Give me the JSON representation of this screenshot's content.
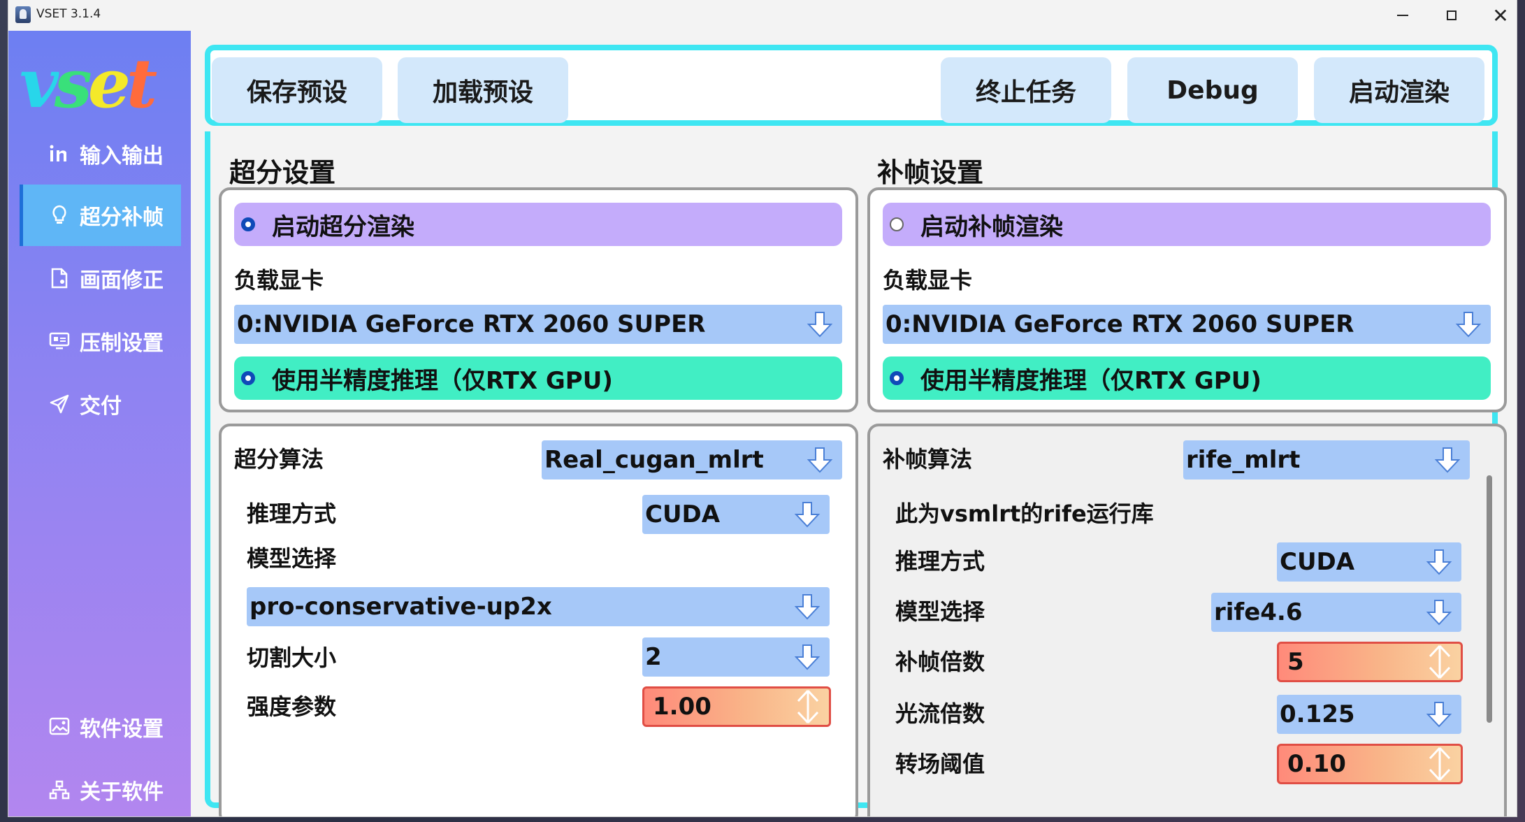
{
  "window": {
    "title": "VSET 3.1.4"
  },
  "sidebar": {
    "logo": {
      "v": "v",
      "s": "s",
      "e": "e",
      "t": "t"
    },
    "items": [
      {
        "label": "输入输出",
        "icon": "in-icon"
      },
      {
        "label": "超分补帧",
        "icon": "bulb-icon"
      },
      {
        "label": "画面修正",
        "icon": "document-icon"
      },
      {
        "label": "压制设置",
        "icon": "monitor-icon"
      },
      {
        "label": "交付",
        "icon": "send-icon"
      },
      {
        "label": "软件设置",
        "icon": "image-settings-icon"
      },
      {
        "label": "关于软件",
        "icon": "sitemap-icon"
      }
    ],
    "active_index": 1
  },
  "toolbar": {
    "save_preset": "保存预设",
    "load_preset": "加载预设",
    "stop_task": "终止任务",
    "debug": "Debug",
    "start_render": "启动渲染"
  },
  "sr": {
    "title": "超分设置",
    "enable_label": "启动超分渲染",
    "enable_checked": true,
    "gpu_label": "负载显卡",
    "gpu_value": "0:NVIDIA GeForce RTX 2060 SUPER",
    "half_label": "使用半精度推理（仅RTX GPU)",
    "half_checked": true,
    "algo_label": "超分算法",
    "algo_value": "Real_cugan_mlrt",
    "infer_label": "推理方式",
    "infer_value": "CUDA",
    "model_label": "模型选择",
    "model_value": "pro-conservative-up2x",
    "tile_label": "切割大小",
    "tile_value": "2",
    "strength_label": "强度参数",
    "strength_value": "1.00"
  },
  "vfi": {
    "title": "补帧设置",
    "enable_label": "启动补帧渲染",
    "enable_checked": false,
    "gpu_label": "负载显卡",
    "gpu_value": "0:NVIDIA GeForce RTX 2060 SUPER",
    "half_label": "使用半精度推理（仅RTX GPU)",
    "half_checked": true,
    "algo_label": "补帧算法",
    "algo_value": "rife_mlrt",
    "note": "此为vsmlrt的rife运行库",
    "infer_label": "推理方式",
    "infer_value": "CUDA",
    "model_label": "模型选择",
    "model_value": "rife4.6",
    "multi_label": "补帧倍数",
    "multi_value": "5",
    "flow_label": "光流倍数",
    "flow_value": "0.125",
    "scene_label": "转场阈值",
    "scene_value": "0.10"
  }
}
